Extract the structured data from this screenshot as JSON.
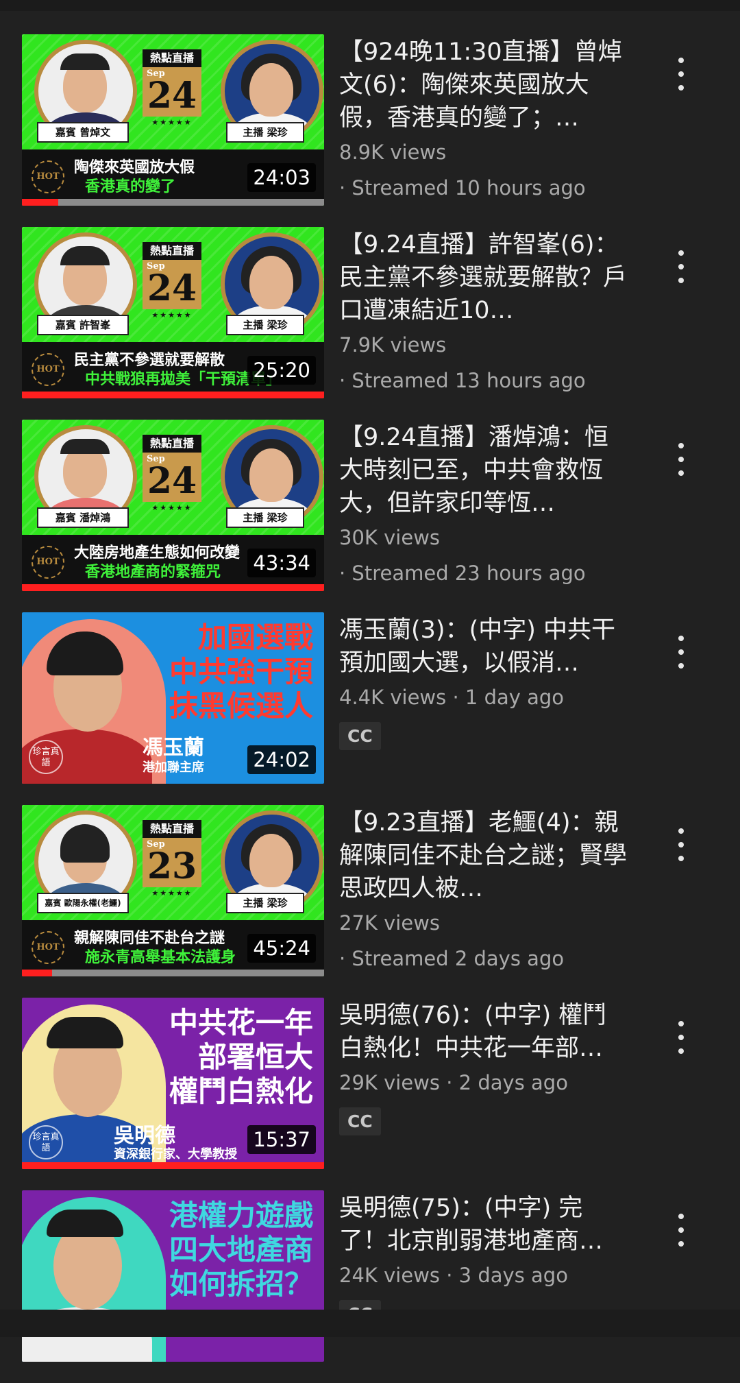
{
  "videos": [
    {
      "title": "【924晚11:30直播】曾焯文(6)：陶傑來英國放大假，香港真的變了；…",
      "line2": "8.9K views",
      "line3": "· Streamed 10 hours ago",
      "duration": "24:03",
      "thumb": {
        "guest_tag": "嘉賓 曾焯文",
        "host_tag": "主播 梁珍",
        "badge_label": "熱點直播",
        "month": "Sep",
        "day": "24",
        "stars": "★★★★★",
        "hot": "HOT",
        "line1": "陶傑來英國放大假",
        "line2": "香港真的變了",
        "progress": 0.12
      }
    },
    {
      "title": "【9.24直播】許智峯(6)：民主黨不參選就要解散？戶口遭凍結近10…",
      "line2": "7.9K views",
      "line3": "· Streamed 13 hours ago",
      "duration": "25:20",
      "thumb": {
        "guest_tag": "嘉賓 許智峯",
        "host_tag": "主播 梁珍",
        "badge_label": "熱點直播",
        "month": "Sep",
        "day": "24",
        "stars": "★★★★★",
        "hot": "HOT",
        "line1": "民主黨不參選就要解散",
        "line2": "中共戰狼再拋美「干預清單」",
        "progress": 1.0
      }
    },
    {
      "title": "【9.24直播】潘焯鴻：恒大時刻已至，中共會救恆大，但許家印等恆…",
      "line2": "30K views",
      "line3": "· Streamed 23 hours ago",
      "duration": "43:34",
      "thumb": {
        "guest_tag": "嘉賓 潘焯鴻",
        "host_tag": "主播 梁珍",
        "badge_label": "熱點直播",
        "month": "Sep",
        "day": "24",
        "stars": "★★★★★",
        "hot": "HOT",
        "line1": "大陸房地產生態如何改變",
        "line2": "香港地產商的緊箍咒",
        "progress": 1.0
      }
    },
    {
      "title": "馮玉蘭(3)：(中字) 中共干預加國大選，以假消…",
      "line2": "4.4K views · 1 day ago",
      "cc": "CC",
      "duration": "24:02",
      "thumb": {
        "headline": [
          "加國選戰",
          "中共強干預",
          "抹黑候選人"
        ],
        "name": "馮玉蘭",
        "role": "港加聯主席",
        "seal": "珍言真語"
      }
    },
    {
      "title": "【9.23直播】老鱷(4)：親解陳同佳不赴台之謎；賢學思政四人被…",
      "line2": "27K views",
      "line3": "· Streamed 2 days ago",
      "duration": "45:24",
      "thumb": {
        "guest_tag": "嘉賓 歐陽永權(老鱷)",
        "host_tag": "主播 梁珍",
        "badge_label": "熱點直播",
        "month": "Sep",
        "day": "23",
        "stars": "★★★★★",
        "hot": "HOT",
        "line1": "親解陳同佳不赴台之謎",
        "line2": "施永青高舉基本法護身",
        "progress": 0.1
      }
    },
    {
      "title": "吳明德(76)：(中字) 權鬥白熱化！中共花一年部…",
      "line2": "29K views · 2 days ago",
      "cc": "CC",
      "duration": "15:37",
      "thumb": {
        "headline": [
          "中共花一年",
          "部署恒大",
          "權鬥白熱化"
        ],
        "name": "吳明德",
        "role": "資深銀行家、大學教授",
        "seal": "珍言真語"
      }
    },
    {
      "title": "吳明德(75)：(中字) 完了！北京削弱港地產商…",
      "line2": "24K views · 3 days ago",
      "cc": "CC",
      "thumb": {
        "headline": [
          "港權力遊戲",
          "四大地產商",
          "如何拆招？"
        ]
      }
    }
  ],
  "colors": {
    "background": "#212121",
    "live_green": "#31e51f",
    "progress_red": "#ff1f1f",
    "guest_purple": "#7b22a8",
    "guest_blue": "#1c8fe0"
  }
}
